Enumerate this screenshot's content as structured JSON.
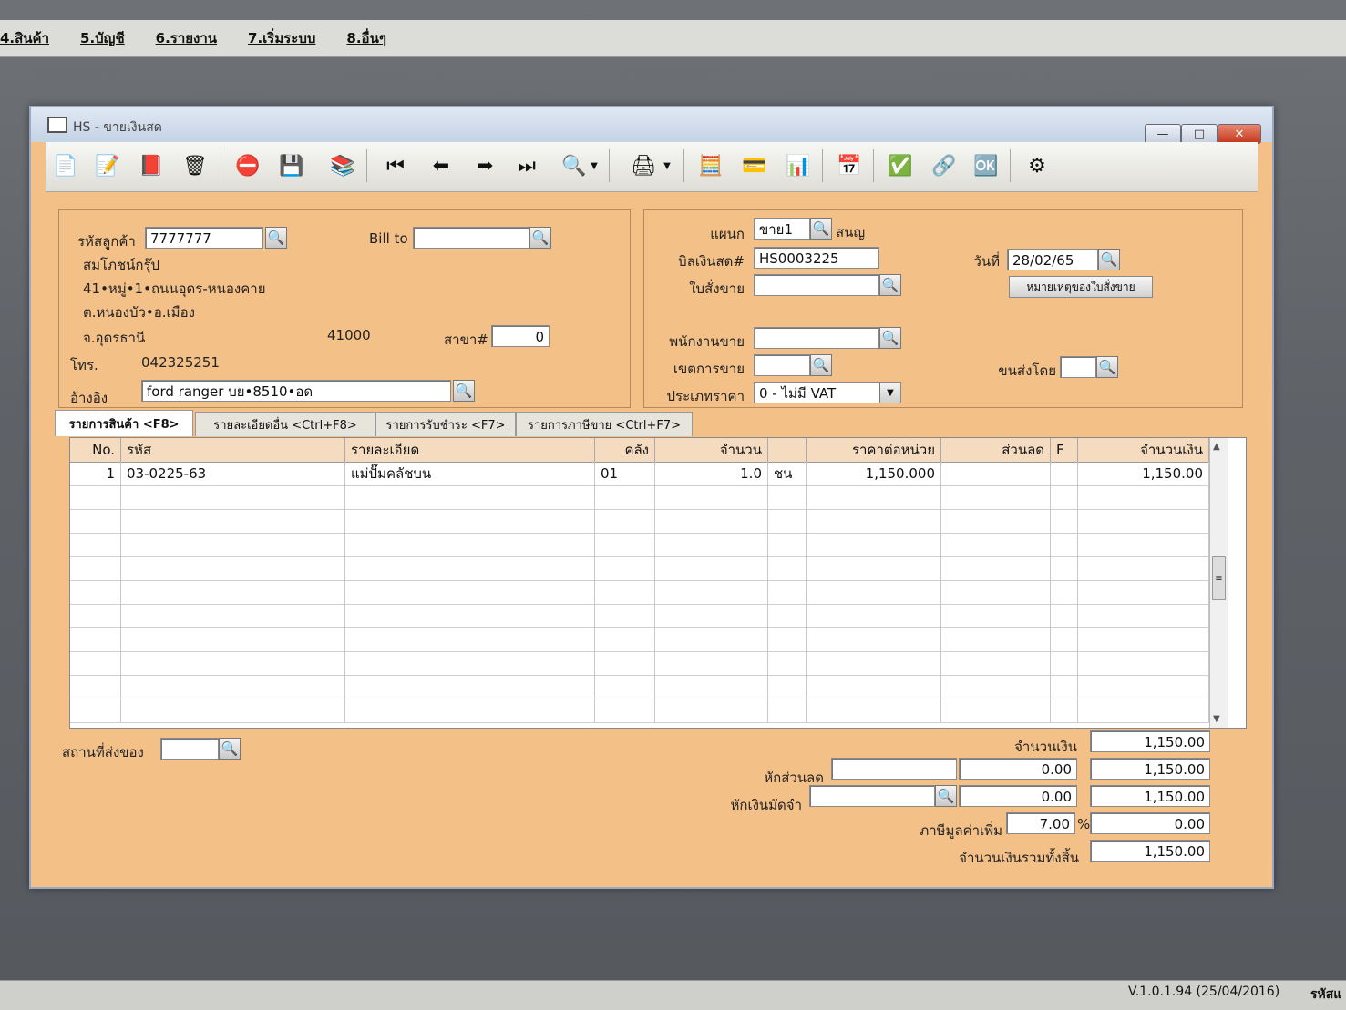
{
  "menu": [
    "4.สินค้า",
    "5.บัญชี",
    "6.รายงาน",
    "7.เริ่มระบบ",
    "8.อื่นๆ"
  ],
  "window": {
    "title": "HS - ขายเงินสด",
    "min": "—",
    "max": "□",
    "close": "✕"
  },
  "customer": {
    "code_label": "รหัสลูกค้า",
    "code": "7777777",
    "bill_to_label": "Bill to",
    "bill_to": "",
    "name": "สมโภชน์กรุ๊ป",
    "address1": "41•หมู่•1•ถนนอุดร-หนองคาย",
    "address2": "ต.หนองบัว•อ.เมือง",
    "province": "จ.อุดรธานี",
    "postcode": "41000",
    "branch_label": "สาขา#",
    "branch": "0",
    "phone_label": "โทร.",
    "phone": "042325251",
    "ref_label": "อ้างอิง",
    "ref": "ford ranger บย•8510•อด"
  },
  "doc": {
    "dept_label": "แผนก",
    "dept": "ขาย1",
    "dept_name": "สนญ",
    "bill_label": "บิลเงินสด#",
    "bill": "HS0003225",
    "date_label": "วันที่",
    "date": "28/02/65",
    "order_label": "ใบสั่งขาย",
    "order": "",
    "note_button": "หมายเหตุของใบสั่งขาย",
    "sales_label": "พนักงานขาย",
    "sales": "",
    "area_label": "เขตการขาย",
    "area": "",
    "ship_label": "ขนส่งโดย",
    "ship": "",
    "price_type_label": "ประเภทราคา",
    "price_type": "0 - ไม่มี VAT"
  },
  "tabs": [
    "รายการสินค้า <F8>",
    "รายละเอียดอื่น <Ctrl+F8>",
    "รายการรับชำระ <F7>",
    "รายการภาษีขาย <Ctrl+F7>"
  ],
  "grid": {
    "headers": [
      "No.",
      "รหัส",
      "รายละเอียด",
      "คลัง",
      "จำนวน",
      "",
      "ราคาต่อหน่วย",
      "ส่วนลด",
      "F",
      "จำนวนเงิน"
    ],
    "rows": [
      [
        "1",
        "03-0225-63",
        "แม่ปั๊มคลัชบน",
        "01",
        "1.0",
        "ชน",
        "1,150.000",
        "",
        "",
        "1,150.00"
      ]
    ]
  },
  "totals": {
    "location_label": "สถานที่ส่งของ",
    "location": "",
    "amount_label": "จำนวนเงิน",
    "amount": "1,150.00",
    "discount_label": "หักส่วนลด",
    "discount_text": "",
    "discount_value": "0.00",
    "after_discount": "1,150.00",
    "deposit_label": "หักเงินมัดจำ",
    "deposit_text": "",
    "deposit_value": "0.00",
    "after_deposit": "1,150.00",
    "vat_label": "ภาษีมูลค่าเพิ่ม",
    "vat_rate": "7.00",
    "vat_pct": "%",
    "vat_amount": "0.00",
    "grand_label": "จำนวนเงินรวมทั้งสิ้น",
    "grand_total": "1,150.00"
  },
  "status": {
    "version": "V.1.0.1.94 (25/04/2016)",
    "code": "รหัสแ"
  }
}
